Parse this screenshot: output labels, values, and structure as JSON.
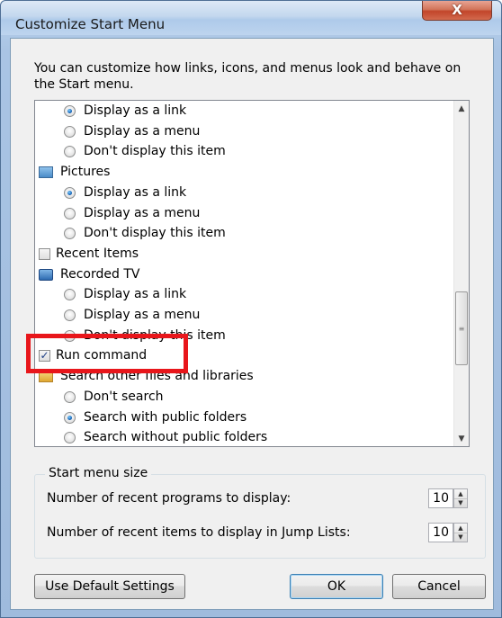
{
  "window": {
    "title": "Customize Start Menu",
    "close_glyph": "X"
  },
  "description": "You can customize how links, icons, and menus look and behave on the Start menu.",
  "list": {
    "items": [
      {
        "kind": "radio",
        "label": "Display as a link",
        "checked": true
      },
      {
        "kind": "radio",
        "label": "Display as a menu",
        "checked": false
      },
      {
        "kind": "radio",
        "label": "Don't display this item",
        "checked": false
      },
      {
        "kind": "category",
        "label": "Pictures",
        "icon": "pictures-icon"
      },
      {
        "kind": "radio",
        "label": "Display as a link",
        "checked": true
      },
      {
        "kind": "radio",
        "label": "Display as a menu",
        "checked": false
      },
      {
        "kind": "radio",
        "label": "Don't display this item",
        "checked": false
      },
      {
        "kind": "checkbox",
        "label": "Recent Items",
        "checked": false
      },
      {
        "kind": "category",
        "label": "Recorded TV",
        "icon": "recorded-tv-icon"
      },
      {
        "kind": "radio",
        "label": "Display as a link",
        "checked": false
      },
      {
        "kind": "radio",
        "label": "Display as a menu",
        "checked": false
      },
      {
        "kind": "radio",
        "label": "Don't display this item",
        "checked": true
      },
      {
        "kind": "checkbox",
        "label": "Run command",
        "checked": true
      },
      {
        "kind": "category",
        "label": "Search other files and libraries",
        "icon": "search-folder-icon"
      },
      {
        "kind": "radio",
        "label": "Don't search",
        "checked": false
      },
      {
        "kind": "radio",
        "label": "Search with public folders",
        "checked": true
      },
      {
        "kind": "radio",
        "label": "Search without public folders",
        "checked": false
      }
    ]
  },
  "start_menu_size": {
    "group_label": "Start menu size",
    "recent_programs_label": "Number of recent programs to display:",
    "recent_programs_value": "10",
    "jump_list_label": "Number of recent items to display in Jump Lists:",
    "jump_list_value": "10"
  },
  "buttons": {
    "defaults": "Use Default Settings",
    "ok": "OK",
    "cancel": "Cancel"
  },
  "colors": {
    "highlight_box": "#e8161b",
    "close_button": "#c2452a"
  }
}
